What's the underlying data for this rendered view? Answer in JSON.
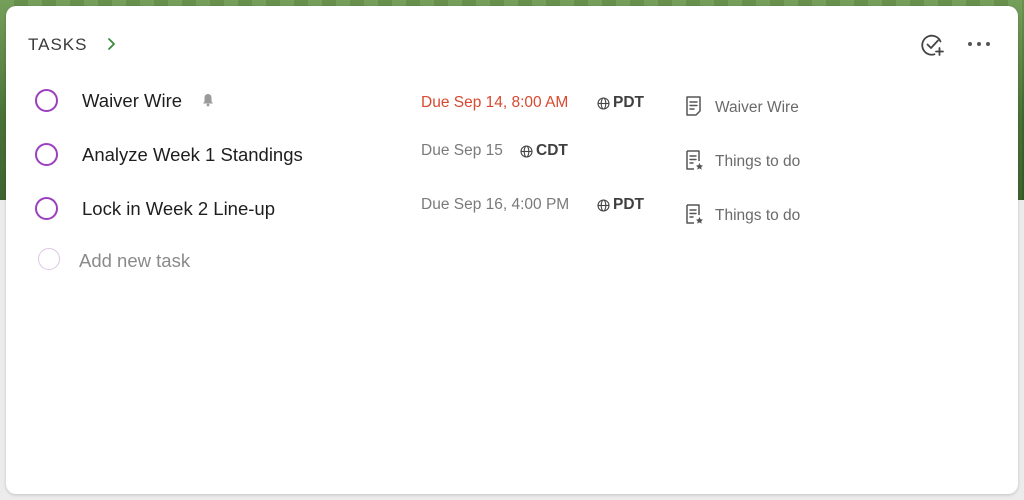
{
  "header": {
    "title": "TASKS",
    "chevron_icon": "chevron-right-icon",
    "add_check_icon": "check-circle-plus-icon",
    "more_icon": "more-horizontal-icon"
  },
  "colors": {
    "accent_circle": "#9b3fbf",
    "overdue": "#d9482f",
    "chevron": "#3a8a3a"
  },
  "tasks": [
    {
      "title": "Waiver Wire",
      "has_reminder": true,
      "due": "Due Sep 14, 8:00 AM",
      "overdue": true,
      "timezone": "PDT",
      "list": "Waiver Wire",
      "list_icon": "note-icon"
    },
    {
      "title": "Analyze Week 1 Standings",
      "has_reminder": false,
      "due": "Due Sep 15",
      "overdue": false,
      "timezone": "CDT",
      "list": "Things to do",
      "list_icon": "note-star-icon"
    },
    {
      "title": "Lock in Week 2 Line-up",
      "has_reminder": false,
      "due": "Due Sep 16, 4:00 PM",
      "overdue": false,
      "timezone": "PDT",
      "list": "Things to do",
      "list_icon": "note-star-icon"
    }
  ],
  "add_task": {
    "placeholder": "Add new task"
  }
}
